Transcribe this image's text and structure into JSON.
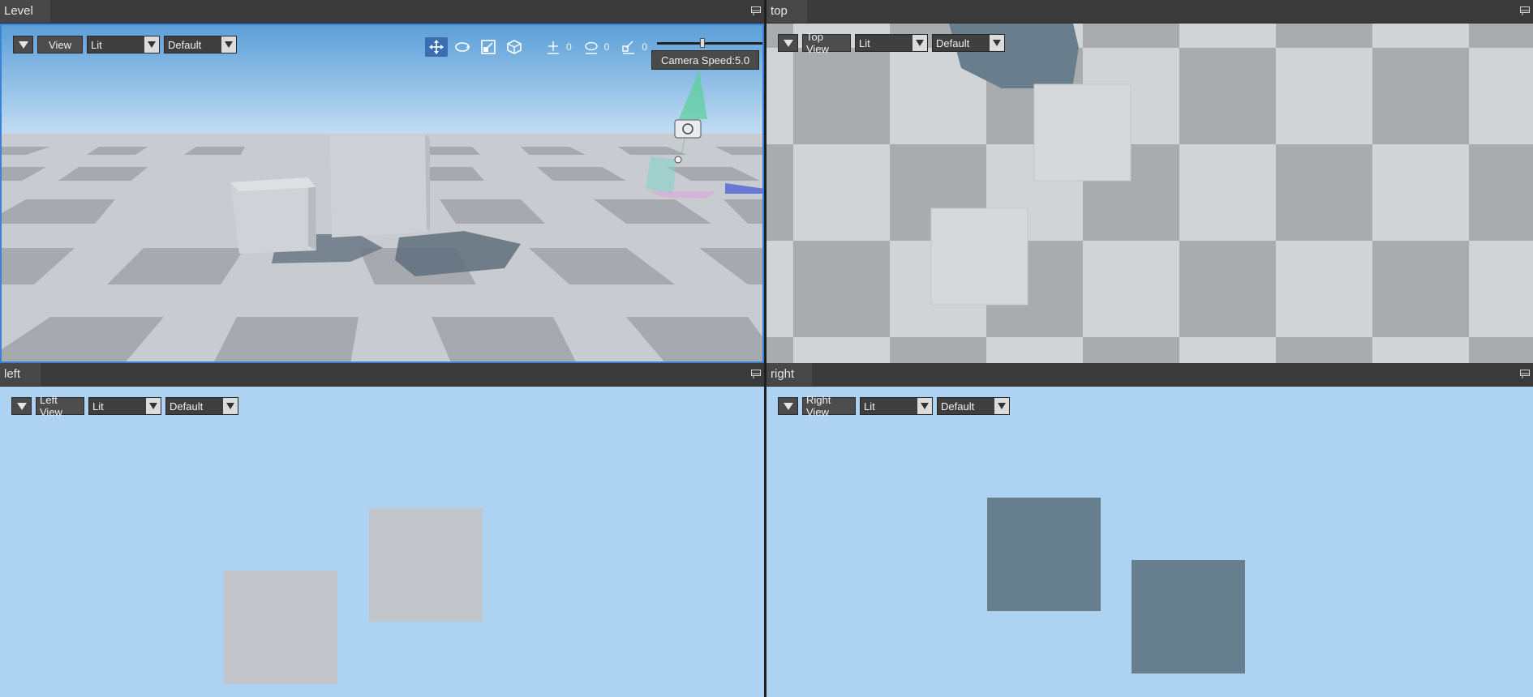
{
  "panes": {
    "level": {
      "tab": "Level",
      "view_label": "View",
      "lit": "Lit",
      "preset": "Default",
      "camera_speed": "Camera Speed:5.0",
      "counts": {
        "translate": "0",
        "rotate": "0",
        "scale": "0"
      },
      "camera_speed_fraction": 0.42
    },
    "top": {
      "tab": "top",
      "view_label": "Top View",
      "lit": "Lit",
      "preset": "Default"
    },
    "left": {
      "tab": "left",
      "view_label": "Left View",
      "lit": "Lit",
      "preset": "Default"
    },
    "right": {
      "tab": "right",
      "view_label": "Right View",
      "lit": "Lit",
      "preset": "Default"
    }
  },
  "colors": {
    "sky_top": "#5b9fd8",
    "sky_bottom": "#bfdaf2",
    "floor_light": "#d2d6d9",
    "floor_dark": "#a5a8ab",
    "ortho_sky": "#aed3f2",
    "box_grey": "#c2c6ca",
    "box_shadow": "#667e8e",
    "active_border": "#3a84d8"
  }
}
